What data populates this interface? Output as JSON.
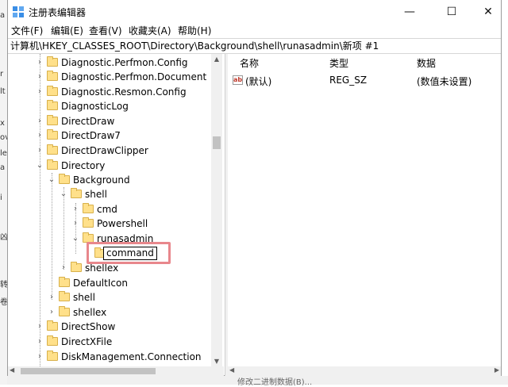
{
  "window": {
    "title": "注册表编辑器",
    "min": "—",
    "max": "☐",
    "close": "✕"
  },
  "menu": [
    "文件(F)",
    "编辑(E)",
    "查看(V)",
    "收藏夹(A)",
    "帮助(H)"
  ],
  "address": "计算机\\HKEY_CLASSES_ROOT\\Directory\\Background\\shell\\runasadmin\\新项 #1",
  "tree": [
    {
      "label": "Diagnostic.Perfmon.Config",
      "chev": "›"
    },
    {
      "label": "Diagnostic.Perfmon.Document",
      "chev": "›"
    },
    {
      "label": "Diagnostic.Resmon.Config",
      "chev": "›"
    },
    {
      "label": "DiagnosticLog",
      "chev": ""
    },
    {
      "label": "DirectDraw",
      "chev": "›"
    },
    {
      "label": "DirectDraw7",
      "chev": "›"
    },
    {
      "label": "DirectDrawClipper",
      "chev": "›"
    },
    {
      "label": "Directory",
      "chev": "⌄"
    },
    {
      "label": "Background",
      "chev": "⌄"
    },
    {
      "label": "shell",
      "chev": "⌄"
    },
    {
      "label": "cmd",
      "chev": "›"
    },
    {
      "label": "Powershell",
      "chev": "›"
    },
    {
      "label": "runasadmin",
      "chev": "⌄"
    },
    {
      "label": "",
      "chev": ""
    },
    {
      "label": "shellex",
      "chev": "›"
    },
    {
      "label": "DefaultIcon",
      "chev": ""
    },
    {
      "label": "shell",
      "chev": "›"
    },
    {
      "label": "shellex",
      "chev": "›"
    },
    {
      "label": "DirectShow",
      "chev": "›"
    },
    {
      "label": "DirectXFile",
      "chev": "›"
    },
    {
      "label": "DiskManagement.Connection",
      "chev": "›"
    }
  ],
  "rename_value": "command",
  "columns": {
    "name": "名称",
    "type": "类型",
    "data": "数据"
  },
  "value_row": {
    "icon": "ab",
    "name": "(默认)",
    "type": "REG_SZ",
    "data": "(数值未设置)"
  },
  "bottom_hint": "修改二进制数据(B)..."
}
